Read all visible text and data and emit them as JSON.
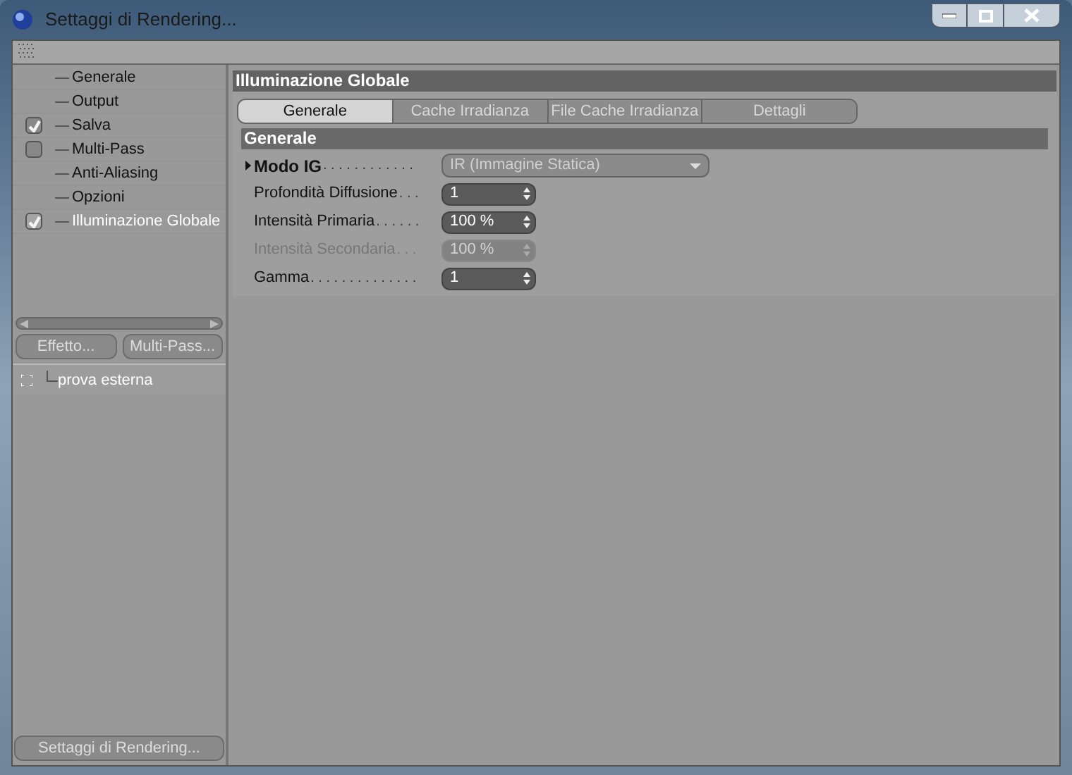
{
  "window": {
    "title": "Settaggi di Rendering..."
  },
  "sidebar": {
    "items": [
      {
        "label": "Generale",
        "selected": false
      },
      {
        "label": "Output",
        "selected": false
      },
      {
        "label": "Salva",
        "selected": false,
        "checked": true
      },
      {
        "label": "Multi-Pass",
        "selected": false,
        "checked": false
      },
      {
        "label": "Anti-Aliasing",
        "selected": false
      },
      {
        "label": "Opzioni",
        "selected": false
      },
      {
        "label": "Illuminazione Globale",
        "selected": true,
        "checked": true
      }
    ],
    "buttons": [
      "Effetto...",
      "Multi-Pass..."
    ],
    "tree": [
      {
        "label": "prova esterna"
      }
    ],
    "bottom_button": "Settaggi di Rendering..."
  },
  "panel": {
    "title": "Illuminazione Globale",
    "tabs": [
      {
        "label": "Generale",
        "selected": true
      },
      {
        "label": "Cache Irradianza",
        "selected": false
      },
      {
        "label": "File Cache Irradianza",
        "selected": false
      },
      {
        "label": "Dettagli",
        "selected": false
      }
    ],
    "section": "Generale",
    "params": [
      {
        "kind": "dropdown",
        "label": "Modo IG",
        "dots": ". . . . . . . . . . . .",
        "value": "IR (Immagine Statica)",
        "disabled": false
      },
      {
        "kind": "spinner",
        "label": "Profondità Diffusione",
        "dots": ". . .",
        "value": "1",
        "disabled": false
      },
      {
        "kind": "spinner",
        "label": "Intensità Primaria",
        "dots": ". . . . . .",
        "value": "100 %",
        "disabled": false
      },
      {
        "kind": "spinner",
        "label": "Intensità Secondaria",
        "dots": ". . .",
        "value": "100 %",
        "disabled": true
      },
      {
        "kind": "spinner",
        "label": "Gamma",
        "dots": ". . . . . . . . . . . . . .",
        "value": "1",
        "disabled": false
      }
    ]
  }
}
